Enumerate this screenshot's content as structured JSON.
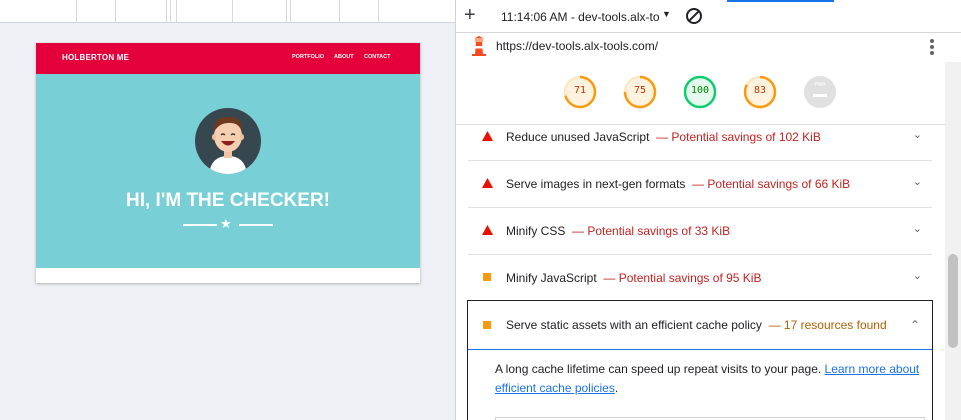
{
  "preview": {
    "brand": "HOLBERTON ME",
    "nav_links": [
      "PORTFOLIO",
      "ABOUT",
      "CONTACT"
    ],
    "hero_title": "HI, I'M THE CHECKER!",
    "nav_color": "#e4003b",
    "hero_color": "#78cfd5"
  },
  "devtools": {
    "timestamp": "11:14:06 AM - dev-tools.alx-to",
    "url": "https://dev-tools.alx-tools.com/",
    "scores": [
      {
        "value": "71",
        "color": "#fa9a0e"
      },
      {
        "value": "75",
        "color": "#fa9a0e"
      },
      {
        "value": "100",
        "color": "#0cce6b"
      },
      {
        "value": "83",
        "color": "#fa9a0e"
      },
      {
        "value": "PWA",
        "color": "#bdbdbd"
      }
    ],
    "audits": [
      {
        "title": "Reduce unused JavaScript",
        "savings": "— Potential savings of 102 KiB",
        "severity": "fail"
      },
      {
        "title": "Serve images in next-gen formats",
        "savings": "— Potential savings of 66 KiB",
        "severity": "fail"
      },
      {
        "title": "Minify CSS",
        "savings": "— Potential savings of 33 KiB",
        "severity": "fail"
      },
      {
        "title": "Minify JavaScript",
        "savings": "— Potential savings of 95 KiB",
        "severity": "average"
      }
    ],
    "expanded_audit": {
      "title": "Serve static assets with an efficient cache policy",
      "summary": "— 17 resources found",
      "description": "A long cache lifetime can speed up repeat visits to your page. ",
      "link": "Learn more about efficient cache policies",
      "trailing": "."
    }
  }
}
